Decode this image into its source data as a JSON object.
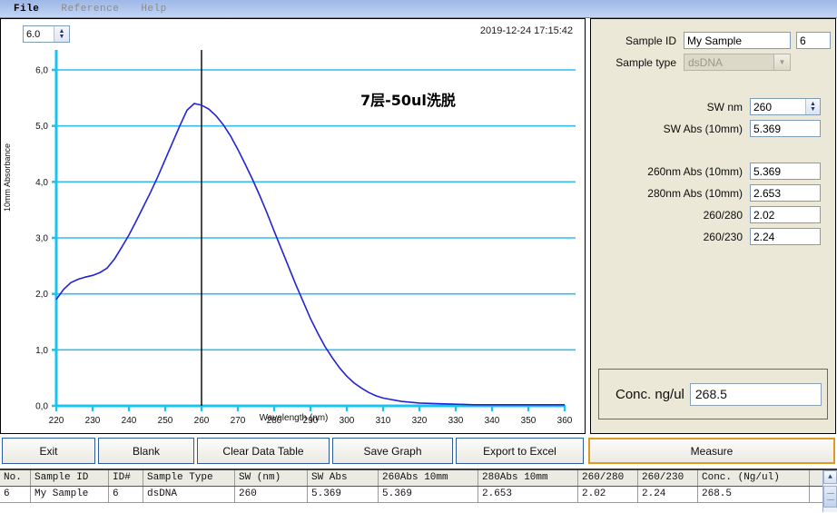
{
  "menu": {
    "items": [
      {
        "label": "File",
        "enabled": true
      },
      {
        "label": "Reference",
        "enabled": false
      },
      {
        "label": "Help",
        "enabled": false
      }
    ]
  },
  "chart_panel": {
    "scale_spinner_value": "6.0",
    "timestamp": "2019-12-24 17:15:42",
    "title": "7层-50ul洗脱",
    "ylabel": "10mm Absorbance",
    "xlabel": "Wavelength (nm)"
  },
  "chart_data": {
    "type": "line",
    "title": "7层-50ul洗脱",
    "xlabel": "Wavelength (nm)",
    "ylabel": "10mm Absorbance",
    "xlim": [
      220,
      360
    ],
    "ylim": [
      0.0,
      6.0
    ],
    "xticks": [
      220,
      230,
      240,
      250,
      260,
      270,
      280,
      290,
      300,
      310,
      320,
      330,
      340,
      350,
      360
    ],
    "yticks": [
      "0,0",
      "1,0",
      "2,0",
      "3,0",
      "4,0",
      "5,0",
      "6,0"
    ],
    "grid": true,
    "legend": "none",
    "line_color": "#2222d8",
    "marker_line": {
      "x": 260,
      "color": "#000000",
      "label": "SW nm 260"
    },
    "series": [
      {
        "name": "Absorbance",
        "x": [
          220,
          222,
          224,
          226,
          228,
          230,
          232,
          234,
          236,
          238,
          240,
          242,
          244,
          246,
          248,
          250,
          252,
          254,
          256,
          258,
          260,
          262,
          264,
          266,
          268,
          270,
          272,
          274,
          276,
          278,
          280,
          282,
          284,
          286,
          288,
          290,
          292,
          294,
          296,
          298,
          300,
          302,
          304,
          306,
          308,
          310,
          315,
          320,
          325,
          330,
          335,
          340,
          345,
          350,
          355,
          360
        ],
        "values": [
          1.9,
          2.08,
          2.2,
          2.26,
          2.3,
          2.33,
          2.38,
          2.46,
          2.62,
          2.83,
          3.05,
          3.3,
          3.56,
          3.82,
          4.1,
          4.4,
          4.7,
          5.0,
          5.28,
          5.4,
          5.37,
          5.3,
          5.18,
          5.02,
          4.82,
          4.58,
          4.32,
          4.05,
          3.76,
          3.45,
          3.12,
          2.8,
          2.48,
          2.16,
          1.86,
          1.56,
          1.3,
          1.06,
          0.86,
          0.68,
          0.53,
          0.41,
          0.32,
          0.24,
          0.18,
          0.14,
          0.08,
          0.05,
          0.04,
          0.03,
          0.02,
          0.02,
          0.02,
          0.02,
          0.02,
          0.02
        ]
      }
    ]
  },
  "right_panel": {
    "sample_id_label": "Sample ID",
    "sample_id_value": "My Sample",
    "sample_number_value": "6",
    "sample_type_label": "Sample type",
    "sample_type_value": "dsDNA",
    "sw_nm_label": "SW nm",
    "sw_nm_value": "260",
    "sw_abs_label": "SW Abs (10mm)",
    "sw_abs_value": "5.369",
    "abs260_label": "260nm Abs (10mm)",
    "abs260_value": "5.369",
    "abs280_label": "280nm Abs (10mm)",
    "abs280_value": "2.653",
    "ratio260_280_label": "260/280",
    "ratio260_280_value": "2.02",
    "ratio260_230_label": "260/230",
    "ratio260_230_value": "2.24",
    "conc_label": "Conc. ng/ul",
    "conc_value": "268.5"
  },
  "buttons": {
    "exit": "Exit",
    "blank": "Blank",
    "clear": "Clear Data Table",
    "save_graph": "Save Graph",
    "export": "Export to Excel",
    "measure": "Measure"
  },
  "table": {
    "columns": [
      "No.",
      "Sample ID",
      "ID#",
      "Sample Type",
      "SW (nm)",
      "SW Abs",
      "260Abs 10mm",
      "280Abs 10mm",
      "260/280",
      "260/230",
      "Conc. (Ng/ul)"
    ],
    "rows": [
      [
        "6",
        "My Sample",
        "6",
        "dsDNA",
        "260",
        "5.369",
        "5.369",
        "2.653",
        "2.02",
        "2.24",
        "268.5"
      ]
    ]
  }
}
